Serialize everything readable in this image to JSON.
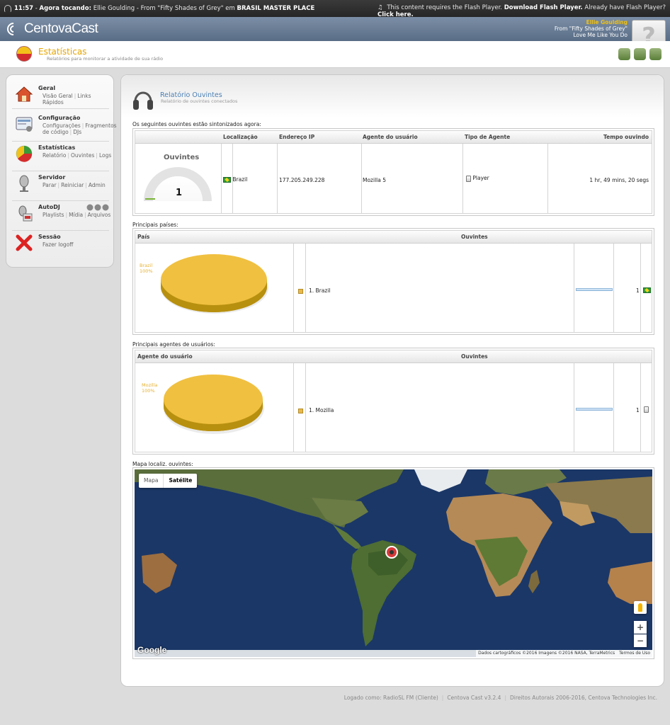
{
  "topbar": {
    "time": "11:57",
    "now_playing_label": "Agora tocando:",
    "track_text": "Ellie Goulding - From \"Fifty Shades of Grey\" em",
    "station": "BRASIL MASTER PLACE",
    "flash_text": "This content requires the Flash Player.",
    "flash_link": "Download Flash Player.",
    "flash_have": "Already have Flash Player?",
    "flash_click": "Click here."
  },
  "header": {
    "logo": "CentovaCast",
    "track_artist": "Ellie Goulding",
    "track_from": "From \"Fifty Shades of Grey\"",
    "track_title": "Love Me Like You Do",
    "help_glyph": "?"
  },
  "page": {
    "title": "Estatísticas",
    "subtitle": "Relatórios para monitorar a atividade de sua rádio"
  },
  "sidebar": {
    "items": [
      {
        "label": "Geral",
        "links": [
          "Visão Geral",
          "Links Rápidos"
        ],
        "icon": "house-icon"
      },
      {
        "label": "Configuração",
        "links": [
          "Configurações",
          "Fragmentos de código",
          "DJs"
        ],
        "icon": "config-icon"
      },
      {
        "label": "Estatísticas",
        "links": [
          "Relatório",
          "Ouvintes",
          "Logs"
        ],
        "icon": "pie-chart-icon"
      },
      {
        "label": "Servidor",
        "links": [
          "Parar",
          "Reiniciar",
          "Admin"
        ],
        "icon": "microphone-icon"
      },
      {
        "label": "AutoDJ",
        "links": [
          "Playlists",
          "Mídia",
          "Arquivos"
        ],
        "icon": "autodj-icon"
      },
      {
        "label": "Sessão",
        "links": [
          "Fazer logoff"
        ],
        "icon": "close-x-icon"
      }
    ]
  },
  "report": {
    "title": "Relatório Ouvintes",
    "subtitle": "Relatório de ouvintes conectados"
  },
  "listeners": {
    "caption": "Os seguintes ouvintes estão sintonizados agora:",
    "headers": [
      "Localização",
      "Endereço IP",
      "Agente do usuário",
      "Tipo de Agente",
      "Tempo ouvindo"
    ],
    "gauge_title": "Ouvintes",
    "gauge_value": "1",
    "row": {
      "location": "Brazil",
      "ip": "177.205.249.228",
      "agent": "Mozilla 5",
      "agent_type": "Player",
      "time": "1 hr, 49 mins, 20 segs"
    }
  },
  "countries": {
    "caption": "Principais países:",
    "headers": [
      "País",
      "Ouvintes"
    ],
    "pie_label": "Brazil",
    "pie_pct": "100%",
    "item": "1. Brazil",
    "count": "1",
    "share": 1.0
  },
  "agents": {
    "caption": "Principais agentes de usuários:",
    "headers": [
      "Agente do usuário",
      "Ouvintes"
    ],
    "pie_label": "Mozilla",
    "pie_pct": "100%",
    "item": "1. Mozilla",
    "count": "1",
    "share": 1.0
  },
  "map": {
    "caption": "Mapa localiz. ouvintes:",
    "tab_map": "Mapa",
    "tab_satellite": "Satélite",
    "zoom_in": "+",
    "zoom_out": "−",
    "google": "Google",
    "credit": "Dados cartográficos ©2016 Imagens ©2016 NASA, TerraMetrics",
    "terms": "Termos de Uso"
  },
  "footer": {
    "logged": "Logado como: RadioSL FM (Cliente)",
    "version": "Centova Cast v3.2.4",
    "rights": "Direitos Autorais 2006-2016, Centova Technologies Inc."
  },
  "colors": {
    "accent": "#e6a400",
    "pie": "#f0c040",
    "pie_side": "#b8900f",
    "map_ocean": "#1a3565"
  }
}
